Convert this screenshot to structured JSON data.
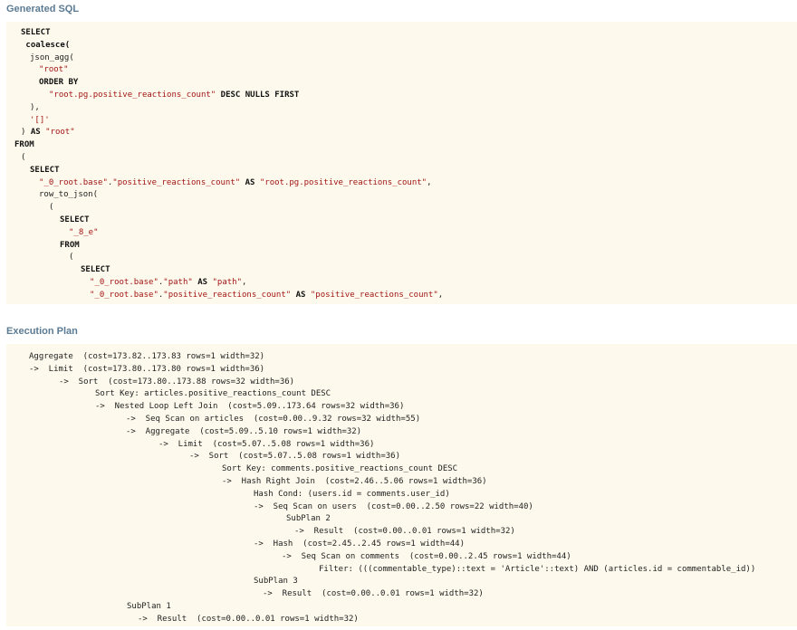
{
  "sql_section": {
    "title": "Generated SQL",
    "lines": [
      {
        "indent": 1,
        "parts": [
          {
            "t": "SELECT",
            "c": "kw"
          }
        ]
      },
      {
        "indent": 1,
        "parts": [
          {
            "t": " coalesce(",
            "c": "kw"
          }
        ]
      },
      {
        "indent": 2,
        "parts": [
          {
            "t": "json_agg(",
            "c": ""
          }
        ]
      },
      {
        "indent": 3,
        "parts": [
          {
            "t": "\"root\"",
            "c": "str"
          }
        ]
      },
      {
        "indent": 3,
        "parts": [
          {
            "t": "ORDER BY",
            "c": "kw"
          }
        ]
      },
      {
        "indent": 4,
        "parts": [
          {
            "t": "\"root.pg.positive_reactions_count\"",
            "c": "str"
          },
          {
            "t": " DESC NULLS FIRST",
            "c": "kw"
          }
        ]
      },
      {
        "indent": 2,
        "parts": [
          {
            "t": "),",
            "c": ""
          }
        ]
      },
      {
        "indent": 2,
        "parts": [
          {
            "t": "'[]'",
            "c": "str"
          }
        ]
      },
      {
        "indent": 1,
        "parts": [
          {
            "t": ") ",
            "c": ""
          },
          {
            "t": "AS",
            "c": "kw"
          },
          {
            "t": " \"root\"",
            "c": "str"
          }
        ]
      },
      {
        "indent": 0,
        "parts": [
          {
            "t": "FROM",
            "c": "kw"
          }
        ]
      },
      {
        "indent": 1,
        "parts": [
          {
            "t": "(",
            "c": ""
          }
        ]
      },
      {
        "indent": 2,
        "parts": [
          {
            "t": "SELECT",
            "c": "kw"
          }
        ]
      },
      {
        "indent": 3,
        "parts": [
          {
            "t": "\"_0_root.base\"",
            "c": "str"
          },
          {
            "t": ".",
            "c": ""
          },
          {
            "t": "\"positive_reactions_count\"",
            "c": "str"
          },
          {
            "t": " AS ",
            "c": "kw"
          },
          {
            "t": "\"root.pg.positive_reactions_count\"",
            "c": "str"
          },
          {
            "t": ",",
            "c": ""
          }
        ]
      },
      {
        "indent": 3,
        "parts": [
          {
            "t": "row_to_json(",
            "c": ""
          }
        ]
      },
      {
        "indent": 4,
        "parts": [
          {
            "t": "(",
            "c": ""
          }
        ]
      },
      {
        "indent": 5,
        "parts": [
          {
            "t": "SELECT",
            "c": "kw"
          }
        ]
      },
      {
        "indent": 6,
        "parts": [
          {
            "t": "\"_8_e\"",
            "c": "str"
          }
        ]
      },
      {
        "indent": 5,
        "parts": [
          {
            "t": "FROM",
            "c": "kw"
          }
        ]
      },
      {
        "indent": 6,
        "parts": [
          {
            "t": "(",
            "c": ""
          }
        ]
      },
      {
        "indent": 7,
        "parts": [
          {
            "t": "SELECT",
            "c": "kw"
          }
        ]
      },
      {
        "indent": 8,
        "parts": [
          {
            "t": "\"_0_root.base\"",
            "c": "str"
          },
          {
            "t": ".",
            "c": ""
          },
          {
            "t": "\"path\"",
            "c": "str"
          },
          {
            "t": " AS ",
            "c": "kw"
          },
          {
            "t": "\"path\"",
            "c": "str"
          },
          {
            "t": ",",
            "c": ""
          }
        ]
      },
      {
        "indent": 8,
        "parts": [
          {
            "t": "\"_0_root.base\"",
            "c": "str"
          },
          {
            "t": ".",
            "c": ""
          },
          {
            "t": "\"positive_reactions_count\"",
            "c": "str"
          },
          {
            "t": " AS ",
            "c": "kw"
          },
          {
            "t": "\"positive_reactions_count\"",
            "c": "str"
          },
          {
            "t": ",",
            "c": ""
          }
        ]
      }
    ]
  },
  "plan_section": {
    "title": "Execution Plan",
    "lines": [
      {
        "level": 0,
        "text": "Aggregate  (cost=173.82..173.83 rows=1 width=32)"
      },
      {
        "level": 1,
        "text": "->  Limit  (cost=173.80..173.80 rows=1 width=36)"
      },
      {
        "level": 2,
        "text": "->  Sort  (cost=173.80..173.88 rows=32 width=36)"
      },
      {
        "level": 3,
        "text": "Sort Key: articles.positive_reactions_count DESC"
      },
      {
        "level": 3,
        "text": "->  Nested Loop Left Join  (cost=5.09..173.64 rows=32 width=36)"
      },
      {
        "level": 4,
        "text": "->  Seq Scan on articles  (cost=0.00..9.32 rows=32 width=55)"
      },
      {
        "level": 4,
        "text": "->  Aggregate  (cost=5.09..5.10 rows=1 width=32)"
      },
      {
        "level": 5,
        "text": "->  Limit  (cost=5.07..5.08 rows=1 width=36)"
      },
      {
        "level": 6,
        "text": "->  Sort  (cost=5.07..5.08 rows=1 width=36)"
      },
      {
        "level": 7,
        "text": "Sort Key: comments.positive_reactions_count DESC"
      },
      {
        "level": 7,
        "text": "->  Hash Right Join  (cost=2.46..5.06 rows=1 width=36)"
      },
      {
        "level": 8,
        "text": "Hash Cond: (users.id = comments.user_id)"
      },
      {
        "level": 8,
        "text": "->  Seq Scan on users  (cost=0.00..2.50 rows=22 width=40)"
      },
      {
        "level": 9,
        "text": "SubPlan 2"
      },
      {
        "level": 10,
        "text": "->  Result  (cost=0.00..0.01 rows=1 width=32)"
      },
      {
        "level": 8,
        "text": "->  Hash  (cost=2.45..2.45 rows=1 width=44)"
      },
      {
        "level": 11,
        "text": "->  Seq Scan on comments  (cost=0.00..2.45 rows=1 width=44)"
      },
      {
        "level": 12,
        "text": "Filter: (((commentable_type)::text = 'Article'::text) AND (articles.id = commentable_id))"
      },
      {
        "level": 8,
        "text": "SubPlan 3"
      },
      {
        "level": 13,
        "text": "->  Result  (cost=0.00..0.01 rows=1 width=32)"
      },
      {
        "level": 14,
        "text": "SubPlan 1"
      },
      {
        "level": 15,
        "text": "->  Result  (cost=0.00..0.01 rows=1 width=32)"
      }
    ]
  }
}
